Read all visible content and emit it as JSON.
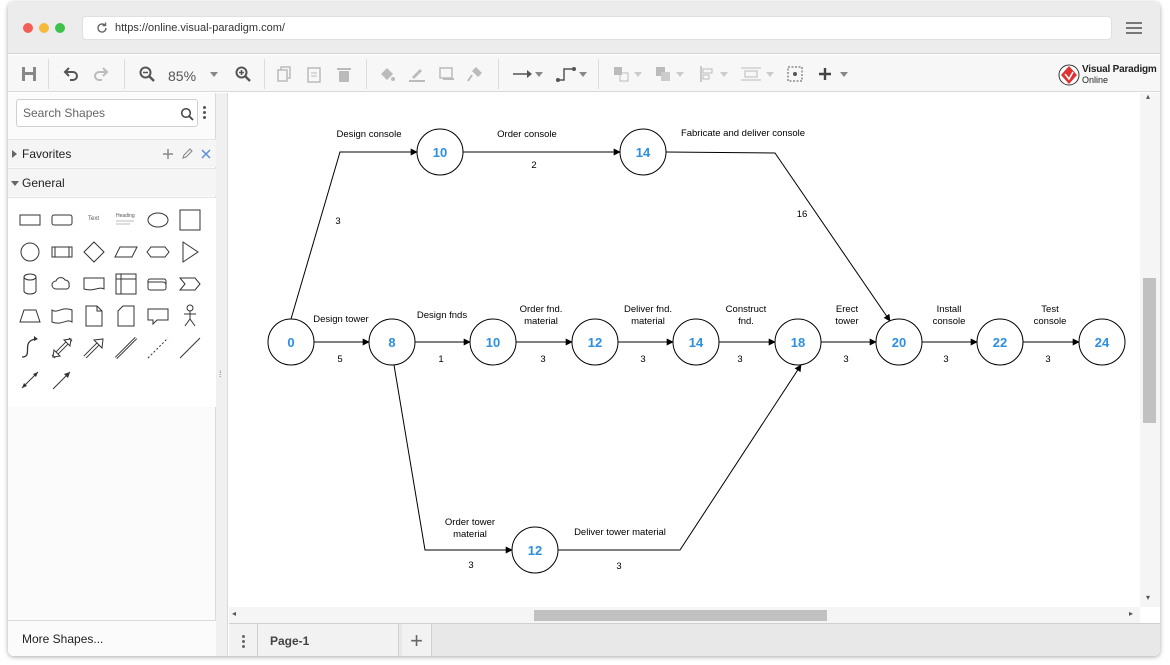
{
  "browser": {
    "url": "https://online.visual-paradigm.com/"
  },
  "toolbar": {
    "zoom_level": "85%",
    "brand_line1": "Visual Paradigm",
    "brand_line2": "Online"
  },
  "sidebar": {
    "search_placeholder": "Search Shapes",
    "favorites_label": "Favorites",
    "general_label": "General",
    "more_shapes_label": "More Shapes...",
    "shape_text_label": "Text",
    "shape_heading_label": "Heading"
  },
  "pages": {
    "current": "Page-1"
  },
  "diagram": {
    "nodes": [
      {
        "id": "n0",
        "label": "0"
      },
      {
        "id": "n8",
        "label": "8"
      },
      {
        "id": "n10a",
        "label": "10"
      },
      {
        "id": "n10b",
        "label": "10"
      },
      {
        "id": "n12a",
        "label": "12"
      },
      {
        "id": "n12b",
        "label": "12"
      },
      {
        "id": "n14a",
        "label": "14"
      },
      {
        "id": "n14b",
        "label": "14"
      },
      {
        "id": "n18",
        "label": "18"
      },
      {
        "id": "n20",
        "label": "20"
      },
      {
        "id": "n22",
        "label": "22"
      },
      {
        "id": "n24",
        "label": "24"
      }
    ],
    "edges": [
      {
        "from": "n0",
        "to": "n10b",
        "activity": "Design console",
        "duration": "3"
      },
      {
        "from": "n10b",
        "to": "n14b",
        "activity": "Order console",
        "duration": "2"
      },
      {
        "from": "n14b",
        "to": "n20",
        "activity": "Fabricate and deliver console",
        "duration": "16"
      },
      {
        "from": "n0",
        "to": "n8",
        "activity": "Design tower",
        "duration": "5"
      },
      {
        "from": "n8",
        "to": "n10a",
        "activity": "Design fnds",
        "duration": "1"
      },
      {
        "from": "n10a",
        "to": "n12a",
        "activity": [
          "Order fnd.",
          "material"
        ],
        "duration": "3"
      },
      {
        "from": "n12a",
        "to": "n14a",
        "activity": [
          "Deliver fnd.",
          "material"
        ],
        "duration": "3"
      },
      {
        "from": "n14a",
        "to": "n18",
        "activity": [
          "Construct",
          "fnd."
        ],
        "duration": "3"
      },
      {
        "from": "n18",
        "to": "n20",
        "activity": [
          "Erect",
          "tower"
        ],
        "duration": "3"
      },
      {
        "from": "n20",
        "to": "n22",
        "activity": [
          "Install",
          "console"
        ],
        "duration": "3"
      },
      {
        "from": "n22",
        "to": "n24",
        "activity": [
          "Test",
          "console"
        ],
        "duration": "3"
      },
      {
        "from": "n8",
        "to": "n12b",
        "activity": [
          "Order tower",
          "material"
        ],
        "duration": "3"
      },
      {
        "from": "n12b",
        "to": "n18",
        "activity": "Deliver tower material",
        "duration": "3"
      }
    ],
    "colors": {
      "node_text": "#2d8fe0",
      "stroke": "#000000",
      "label": "#000000"
    }
  }
}
